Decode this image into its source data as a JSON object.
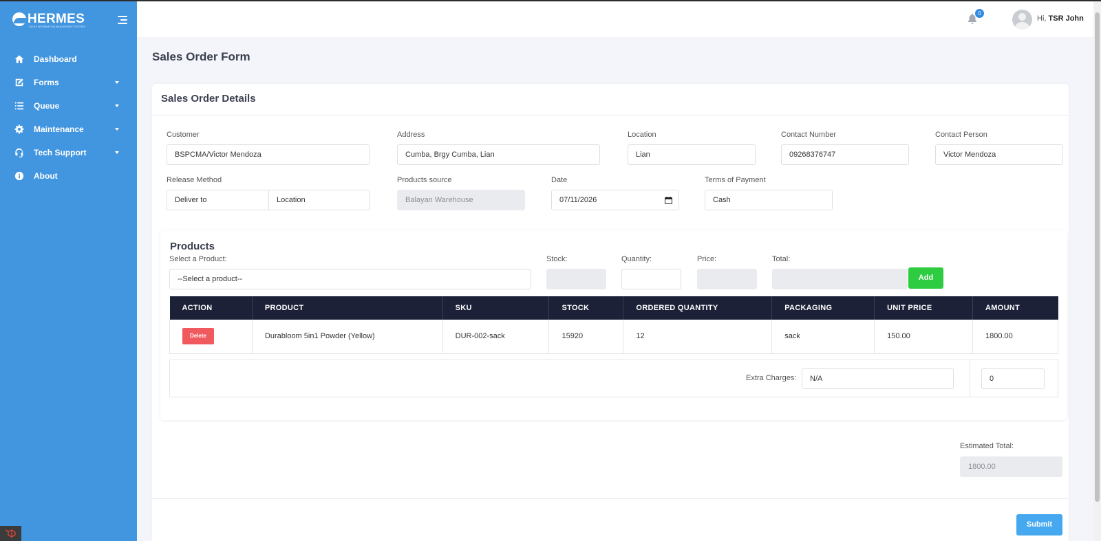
{
  "brand": {
    "name": "HERMES",
    "tagline": "SALES INFORMATION MANAGEMENT SYSTEM"
  },
  "sidebar": {
    "items": [
      {
        "label": "Dashboard",
        "icon": "home-icon",
        "has_caret": false
      },
      {
        "label": "Forms",
        "icon": "edit-icon",
        "has_caret": true
      },
      {
        "label": "Queue",
        "icon": "list-icon",
        "has_caret": true
      },
      {
        "label": "Maintenance",
        "icon": "gear-icon",
        "has_caret": true
      },
      {
        "label": "Tech Support",
        "icon": "headset-icon",
        "has_caret": true
      },
      {
        "label": "About",
        "icon": "info-icon",
        "has_caret": false
      }
    ]
  },
  "topbar": {
    "notification_count": "0",
    "greeting_prefix": "Hi,",
    "user_name": "TSR John"
  },
  "page": {
    "title": "Sales Order Form"
  },
  "details": {
    "title": "Sales Order Details",
    "customer_label": "Customer",
    "customer_value": "BSPCMA/Victor Mendoza",
    "address_label": "Address",
    "address_value": "Cumba, Brgy Cumba, Lian",
    "location_label": "Location",
    "location_value": "Lian",
    "contact_number_label": "Contact Number",
    "contact_number_value": "09268376747",
    "contact_person_label": "Contact Person",
    "contact_person_value": "Victor Mendoza",
    "release_method_label": "Release Method",
    "release_method_value": "Deliver to",
    "release_location_value": "Location",
    "products_source_label": "Products source",
    "products_source_value": "Balayan Warehouse",
    "date_label": "Date",
    "date_value": "07/11/2026",
    "terms_label": "Terms of Payment",
    "terms_value": "Cash"
  },
  "products": {
    "title": "Products",
    "select_label": "Select a Product:",
    "select_placeholder": "--Select a product--",
    "stock_label": "Stock:",
    "quantity_label": "Quantity:",
    "price_label": "Price:",
    "total_label": "Total:",
    "add_label": "Add",
    "columns": [
      "ACTION",
      "PRODUCT",
      "SKU",
      "STOCK",
      "ORDERED QUANTITY",
      "PACKAGING",
      "UNIT PRICE",
      "AMOUNT"
    ],
    "rows": [
      {
        "action": "Delete",
        "product": "Durabloom 5in1 Powder (Yellow)",
        "sku": "DUR-002-sack",
        "stock": "15920",
        "ordered_quantity": "12",
        "packaging": "sack",
        "unit_price": "150.00",
        "amount": "1800.00"
      }
    ],
    "extra_charges_label": "Extra Charges:",
    "extra_charges_desc": "N/A",
    "extra_charges_amount": "0"
  },
  "summary": {
    "estimated_total_label": "Estimated Total:",
    "estimated_total_value": "1800.00",
    "submit_label": "Submit"
  },
  "colors": {
    "sidebar": "#4295df",
    "table_header": "#1c2138",
    "add_button": "#2ecc40",
    "delete_button": "#f05a5f",
    "submit_button": "#46a9f0"
  }
}
